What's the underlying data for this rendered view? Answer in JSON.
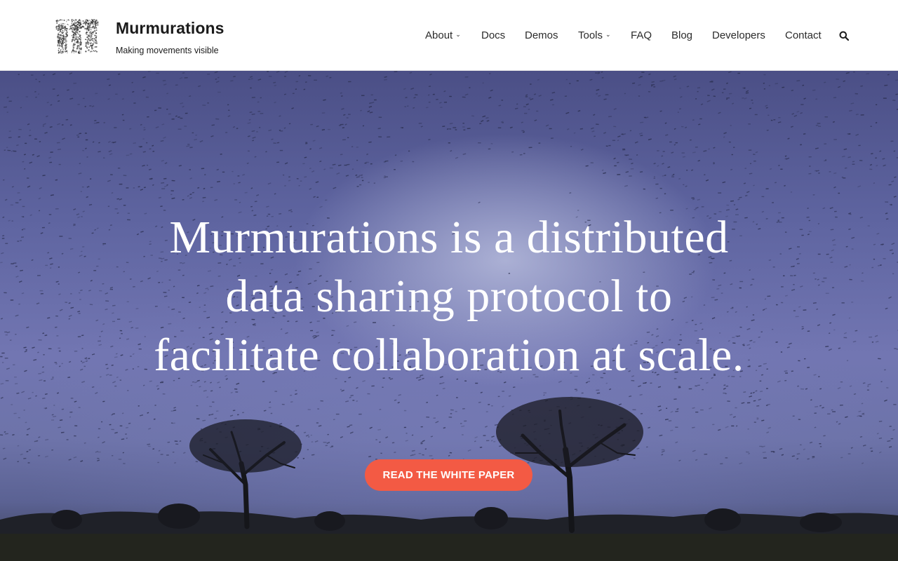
{
  "site": {
    "title": "Murmurations",
    "tagline": "Making movements visible",
    "logo_icon": "murmuration-m-logo-icon"
  },
  "nav": {
    "items": [
      {
        "label": "About",
        "has_dropdown": true
      },
      {
        "label": "Docs",
        "has_dropdown": false
      },
      {
        "label": "Demos",
        "has_dropdown": false
      },
      {
        "label": "Tools",
        "has_dropdown": true
      },
      {
        "label": "FAQ",
        "has_dropdown": false
      },
      {
        "label": "Blog",
        "has_dropdown": false
      },
      {
        "label": "Developers",
        "has_dropdown": false
      },
      {
        "label": "Contact",
        "has_dropdown": false
      }
    ],
    "search_icon": "search-icon"
  },
  "hero": {
    "heading_lines": [
      "Murmurations is a distributed",
      "data sharing protocol to",
      "facilitate collaboration at scale."
    ],
    "cta_label": "READ THE WHITE PAPER"
  },
  "colors": {
    "cta": "#f35a44",
    "text_dark": "#1b1b1b",
    "sky": "#6d73a9"
  }
}
